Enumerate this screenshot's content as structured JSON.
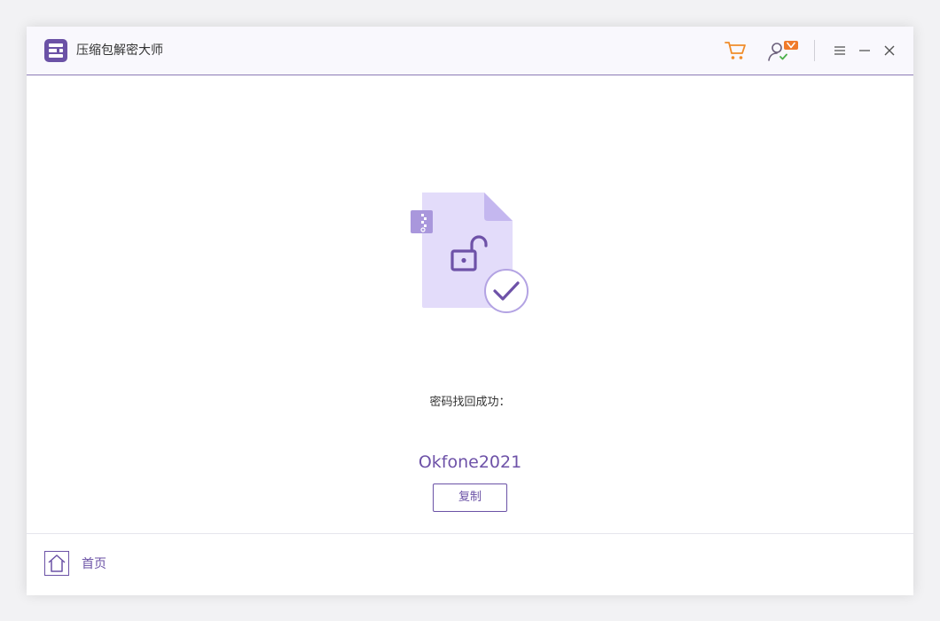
{
  "app": {
    "title": "压缩包解密大师"
  },
  "titlebar": {
    "icons": {
      "cart": "cart-icon",
      "account": "user-vip-icon",
      "menu": "hamburger-menu-icon",
      "minimize": "minimize-icon",
      "close": "close-icon"
    },
    "colors": {
      "accent": "#6b52a6",
      "cart": "#f08c2a",
      "vip_badge": "#f07a2a"
    }
  },
  "result": {
    "label": "密码找回成功：",
    "password": "Okfone2021",
    "copy_label": "复制",
    "illustration_icons": [
      "zip-file-icon",
      "unlock-icon",
      "check-circle-icon"
    ]
  },
  "footer": {
    "home_label": "首页",
    "home_icon": "home-icon"
  }
}
